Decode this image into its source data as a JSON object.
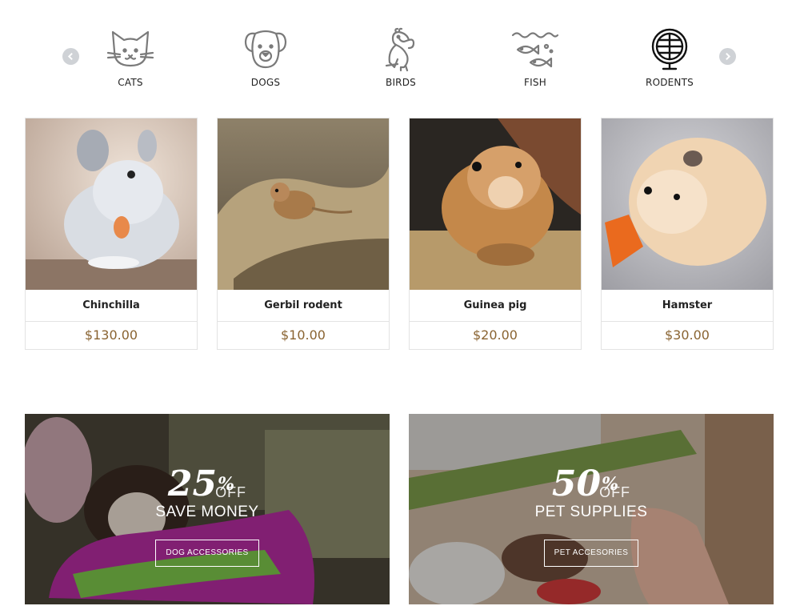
{
  "categories": {
    "items": [
      {
        "label": "CATS",
        "icon": "cat-icon"
      },
      {
        "label": "DOGS",
        "icon": "dog-icon"
      },
      {
        "label": "BIRDS",
        "icon": "bird-icon"
      },
      {
        "label": "FISH",
        "icon": "fish-icon"
      },
      {
        "label": "RODENTS",
        "icon": "hamster-wheel-icon"
      }
    ],
    "prev_icon": "chevron-left-icon",
    "next_icon": "chevron-right-icon"
  },
  "products": [
    {
      "name": "Chinchilla",
      "price": "$130.00"
    },
    {
      "name": "Gerbil rodent",
      "price": "$10.00"
    },
    {
      "name": "Guinea pig",
      "price": "$20.00"
    },
    {
      "name": "Hamster",
      "price": "$30.00"
    }
  ],
  "banners": [
    {
      "percent": "25",
      "percent_sign": "%",
      "off": "OFF",
      "subtitle": "SAVE MONEY",
      "button": "DOG ACCESSORIES"
    },
    {
      "percent": "50",
      "percent_sign": "%",
      "off": "OFF",
      "subtitle": "PET SUPPLIES",
      "button": "PET ACCESORIES"
    }
  ],
  "colors": {
    "price": "#8a6432",
    "arrow": "#cfd2d6",
    "icon_gray": "#7a7a7a"
  }
}
